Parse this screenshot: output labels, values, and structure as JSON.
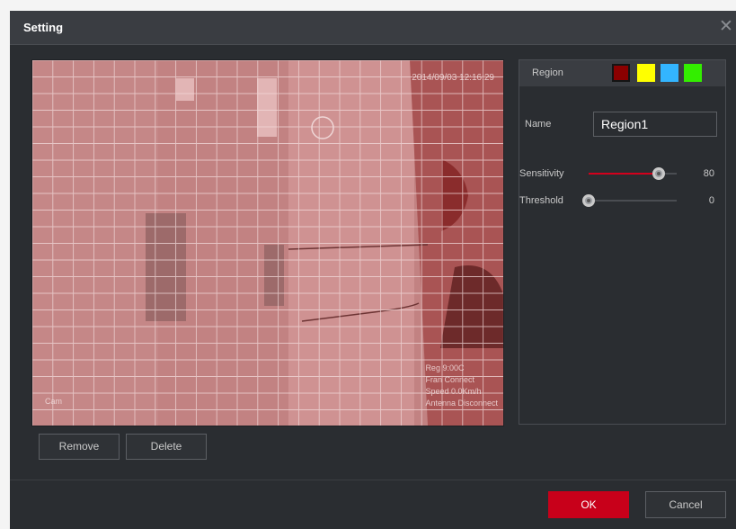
{
  "dialog": {
    "title": "Setting",
    "close_icon": "close-icon"
  },
  "video": {
    "timestamp": "2014/09/03 12:16:29",
    "info_lines": [
      "Reg 9:00C",
      "Fran Connect",
      "Speed 0.0Km/h",
      "Antenna Disconnect"
    ],
    "corner_text": "Cam",
    "grid_color": "#f2dada",
    "overlay_color": "#c96a6a"
  },
  "buttons": {
    "remove": "Remove",
    "delete": "Delete",
    "ok": "OK",
    "cancel": "Cancel"
  },
  "panel": {
    "region_label": "Region",
    "colors": [
      {
        "name": "dark-red",
        "hex": "#8b0000",
        "selected": true
      },
      {
        "name": "yellow",
        "hex": "#ffff00",
        "selected": false
      },
      {
        "name": "light-blue",
        "hex": "#33b5ff",
        "selected": false
      },
      {
        "name": "green",
        "hex": "#33ee00",
        "selected": false
      }
    ],
    "name_label": "Name",
    "name_value": "Region1",
    "sensitivity_label": "Sensitivity",
    "sensitivity_value": "80",
    "sensitivity_fraction": 0.8,
    "threshold_label": "Threshold",
    "threshold_value": "0",
    "threshold_fraction": 0.0
  }
}
